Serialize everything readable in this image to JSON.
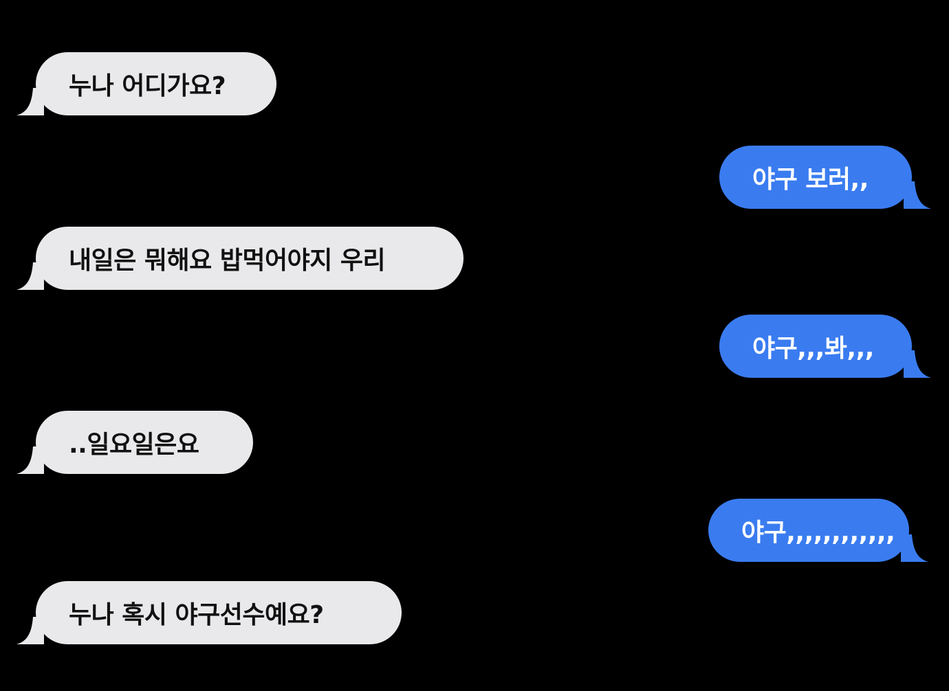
{
  "conversation": {
    "messages": [
      {
        "direction": "received",
        "text": "누나 어디가요?"
      },
      {
        "direction": "sent",
        "text": "야구 보러,,"
      },
      {
        "direction": "received",
        "text": "내일은 뭐해요 밥먹어야지 우리"
      },
      {
        "direction": "sent",
        "text": "야구,,,봐,,,"
      },
      {
        "direction": "received",
        "text": "..일요일은요"
      },
      {
        "direction": "sent",
        "text": "야구,,,,,,,,,,,,"
      },
      {
        "direction": "received",
        "text": "누나 혹시 야구선수예요?"
      }
    ]
  },
  "colors": {
    "background": "#000000",
    "received_bubble": "#e9e9eb",
    "received_text": "#111111",
    "sent_bubble": "#3a7cf0",
    "sent_text": "#ffffff"
  }
}
